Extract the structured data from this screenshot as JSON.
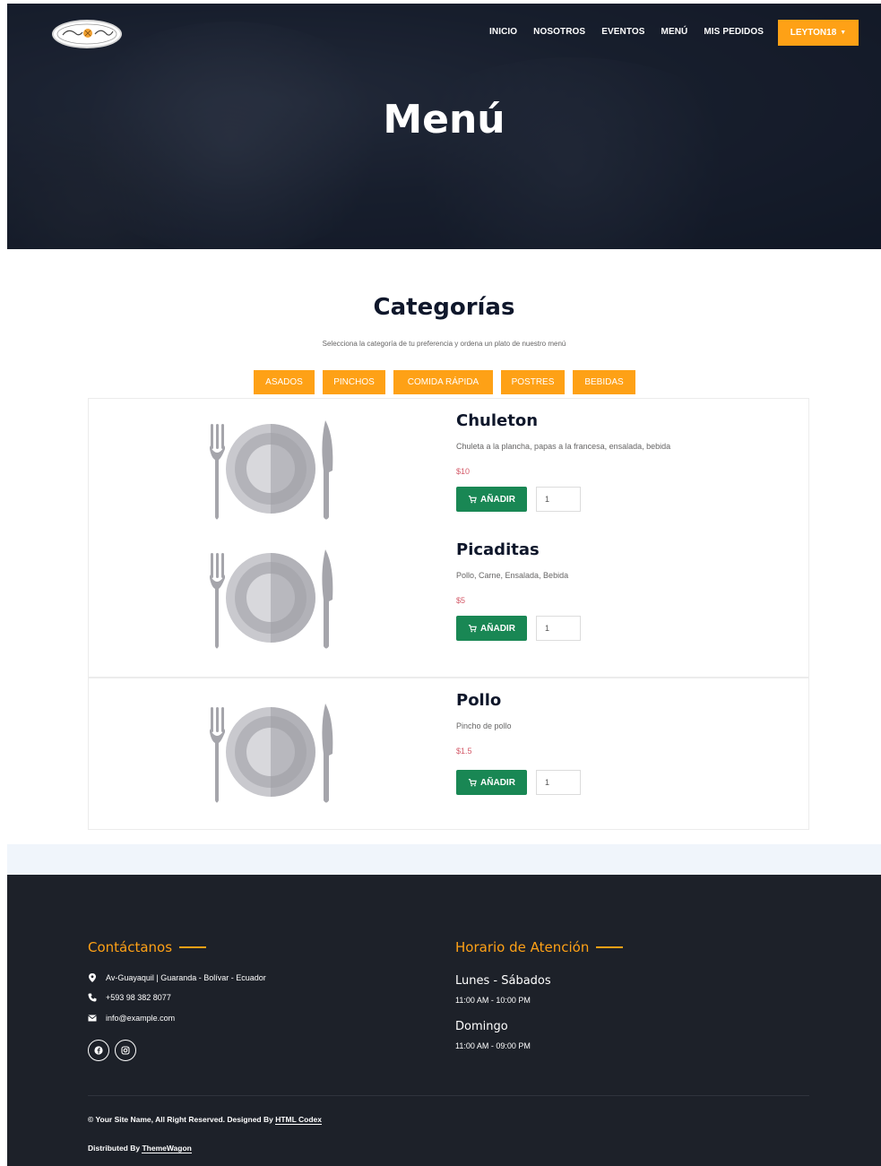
{
  "nav": {
    "items": [
      "INICIO",
      "NOSOTROS",
      "EVENTOS",
      "MENÚ",
      "MIS PEDIDOS"
    ],
    "user_button": "LEYTON18"
  },
  "hero": {
    "title": "Menú"
  },
  "categories": {
    "title": "Categorías",
    "subtitle": "Selecciona la categoría de tu preferencia y ordena un plato de nuestro menú",
    "tabs": [
      "ASADOS",
      "PINCHOS",
      "COMIDA RÁPIDA",
      "POSTRES",
      "BEBIDAS"
    ]
  },
  "items": [
    {
      "name": "Chuleton",
      "description": "Chuleta a la plancha, papas a la francesa, ensalada, bebida",
      "price": "$10",
      "button": "AÑADIR",
      "quantity": "1"
    },
    {
      "name": "Picaditas",
      "description": "Pollo, Carne, Ensalada, Bebida",
      "price": "$5",
      "button": "AÑADIR",
      "quantity": "1"
    },
    {
      "name": "Pollo",
      "description": "Pincho de pollo",
      "price": "$1.5",
      "button": "AÑADIR",
      "quantity": "1"
    }
  ],
  "footer": {
    "contact_heading": "Contáctanos",
    "address": "Av-Guayaquil | Guaranda - Bolívar - Ecuador",
    "phone": "+593 98 382 8077",
    "email": "info@example.com",
    "hours_heading": "Horario de Atención",
    "days1": "Lunes - Sábados",
    "hours1": "11:00 AM - 10:00 PM",
    "days2": "Domingo",
    "hours2": "11:00 AM - 09:00 PM",
    "copyright_prefix": "© Your Site Name, All Right Reserved. Designed By ",
    "designer": "HTML Codex",
    "distributed_prefix": "Distributed By ",
    "distributor": "ThemeWagon"
  },
  "colors": {
    "accent": "#fea116",
    "add_button": "#198754",
    "footer_bg": "#1d2129",
    "price": "#d45b6a"
  }
}
